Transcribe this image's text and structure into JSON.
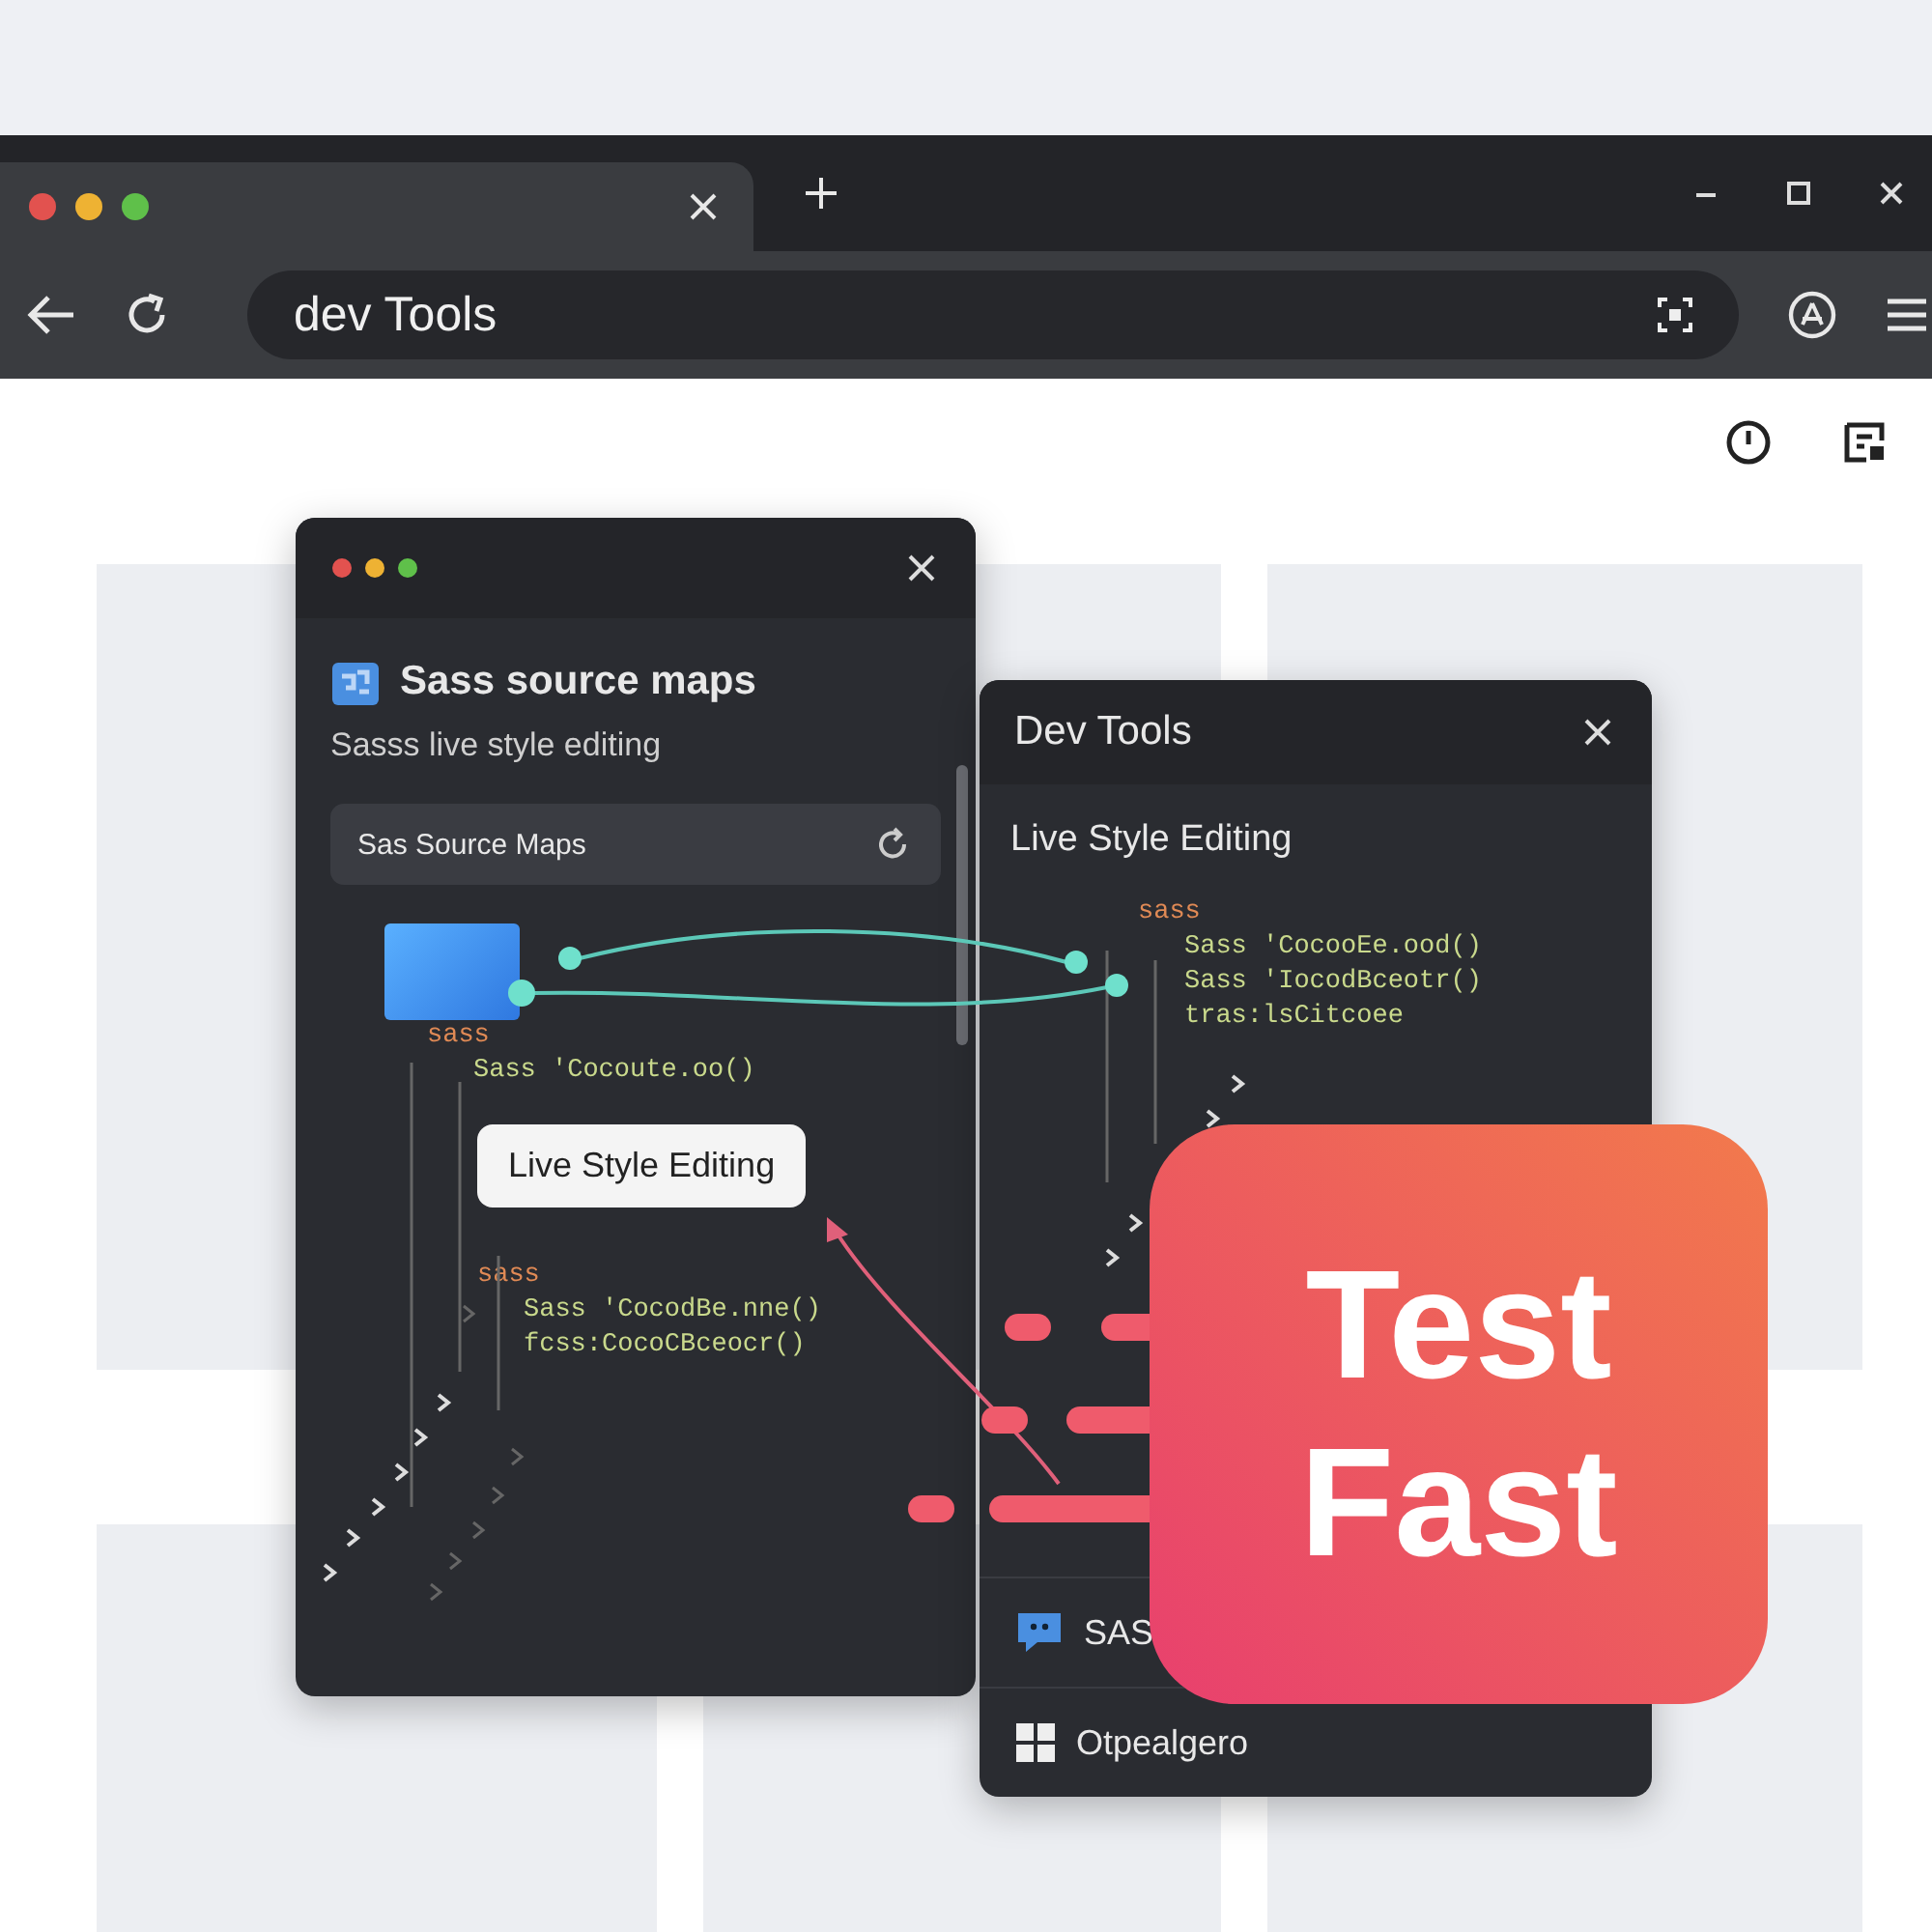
{
  "browser": {
    "address": "dev Tools"
  },
  "left_panel": {
    "title": "Sass source maps",
    "subtitle": "Sasss live style editing",
    "field": "Sas Source Maps",
    "code": [
      {
        "kind": "keyword",
        "text": "sass",
        "children": [
          {
            "kind": "statement",
            "text": "Sass 'Cocoute.oo()"
          }
        ]
      },
      {
        "kind": "keyword",
        "text": "sass",
        "children": [
          {
            "kind": "statement",
            "text": "Sass 'CocodBe.nne()"
          },
          {
            "kind": "statement",
            "text": "fcss:CocoCBceocr()"
          }
        ]
      }
    ],
    "tooltip": "Live Style Editing"
  },
  "right_panel": {
    "title": "Dev Tools",
    "heading": "Live Style Editing",
    "code": [
      {
        "kind": "keyword",
        "text": "sass",
        "children": [
          {
            "kind": "statement",
            "text": "Sass 'CocooEe.ood()"
          },
          {
            "kind": "statement",
            "text": "Sass 'IocodBceotr()"
          },
          {
            "kind": "statement",
            "text": "tras:lsCitcoee"
          }
        ]
      }
    ],
    "items": [
      {
        "kind": "chat",
        "label": "SAS"
      },
      {
        "kind": "grid",
        "label": "Otpealgero"
      }
    ]
  },
  "badge": {
    "text": "Test Fast"
  }
}
